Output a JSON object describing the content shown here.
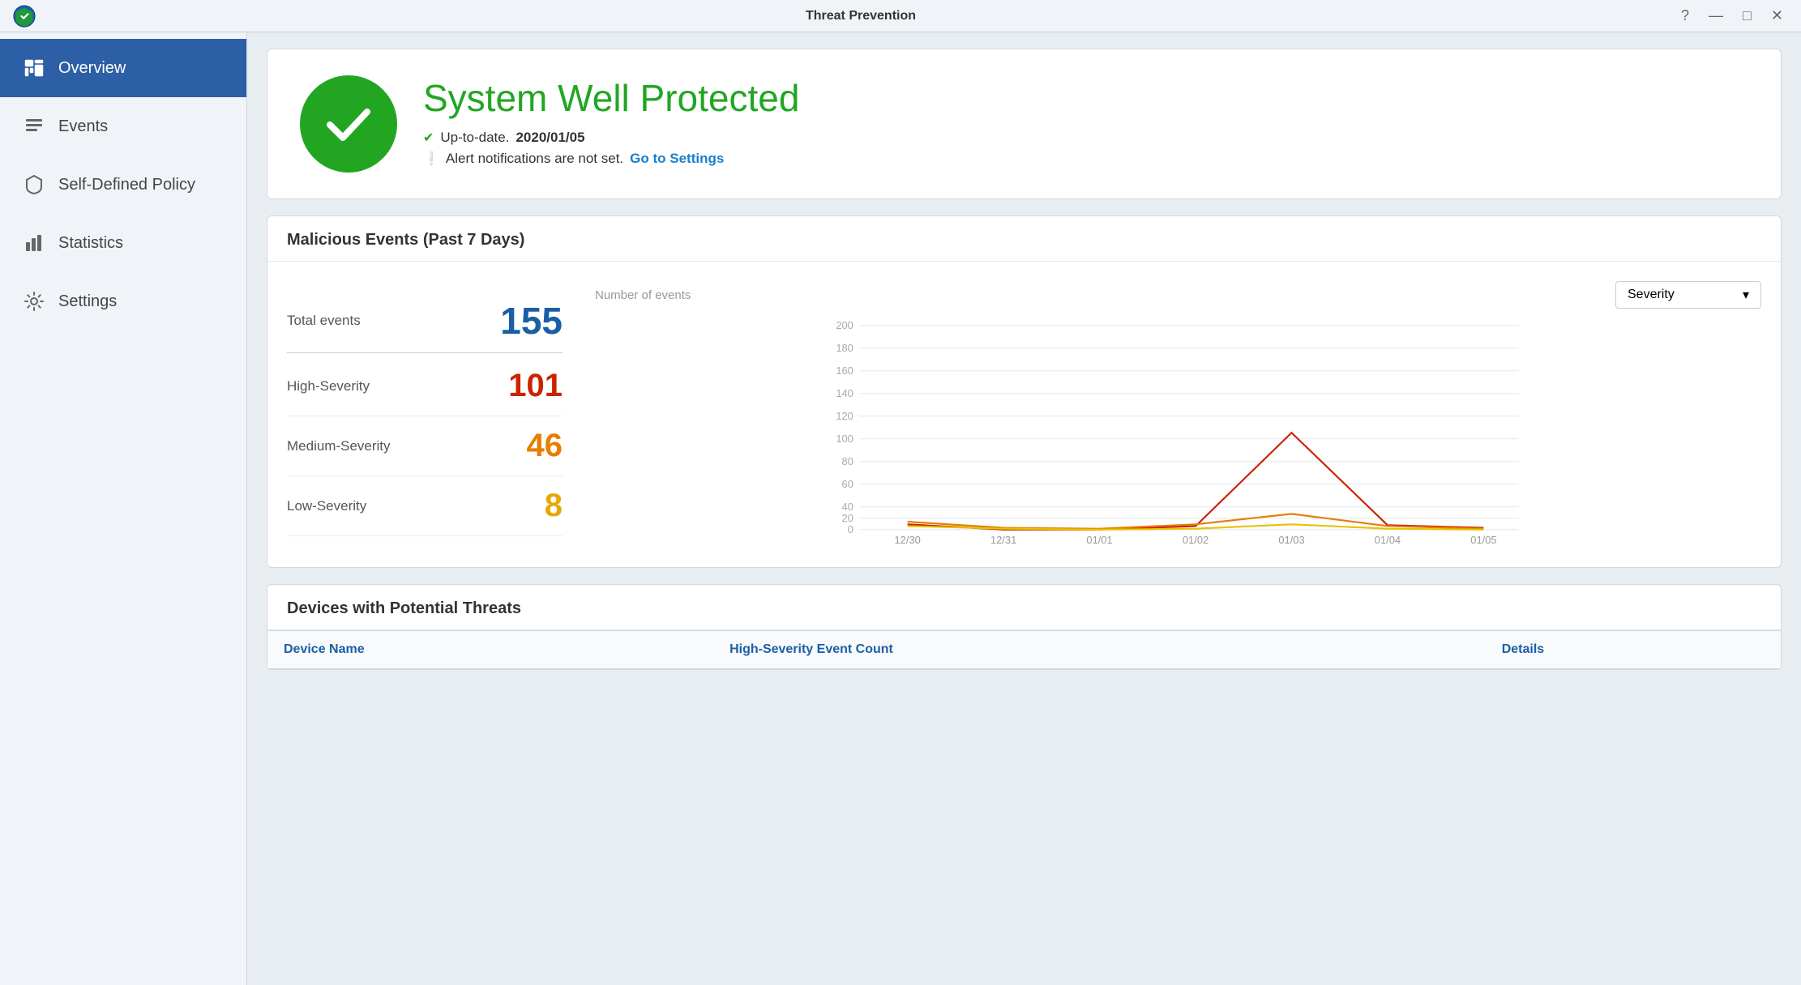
{
  "titlebar": {
    "title": "Threat Prevention",
    "controls": [
      "?",
      "—",
      "□",
      "✕"
    ]
  },
  "sidebar": {
    "items": [
      {
        "id": "overview",
        "label": "Overview",
        "icon": "overview",
        "active": true
      },
      {
        "id": "events",
        "label": "Events",
        "icon": "events",
        "active": false
      },
      {
        "id": "self-defined-policy",
        "label": "Self-Defined Policy",
        "icon": "policy",
        "active": false
      },
      {
        "id": "statistics",
        "label": "Statistics",
        "icon": "statistics",
        "active": false
      },
      {
        "id": "settings",
        "label": "Settings",
        "icon": "settings",
        "active": false
      }
    ]
  },
  "status": {
    "title": "System Well Protected",
    "uptodate_label": "Up-to-date.",
    "uptodate_date": "2020/01/05",
    "alert_text": "Alert notifications are not set.",
    "alert_link": "Go to Settings"
  },
  "malicious_events": {
    "section_title": "Malicious Events (Past 7 Days)",
    "chart_label": "Number of events",
    "dropdown_value": "Severity",
    "stats": {
      "total_label": "Total events",
      "total_value": "155",
      "high_label": "High-Severity",
      "high_value": "101",
      "medium_label": "Medium-Severity",
      "medium_value": "46",
      "low_label": "Low-Severity",
      "low_value": "8"
    },
    "chart": {
      "y_labels": [
        "200",
        "180",
        "160",
        "140",
        "120",
        "100",
        "80",
        "60",
        "40",
        "20",
        "0"
      ],
      "x_labels": [
        "12/30",
        "12/31",
        "01/01",
        "01/02",
        "01/03",
        "01/04",
        "01/05"
      ],
      "high_data": [
        5,
        0,
        0,
        3,
        95,
        4,
        2
      ],
      "medium_data": [
        8,
        2,
        1,
        5,
        15,
        3,
        1
      ],
      "low_data": [
        3,
        1,
        0,
        1,
        5,
        1,
        0
      ]
    }
  },
  "devices": {
    "section_title": "Devices with Potential Threats",
    "columns": [
      "Device Name",
      "High-Severity Event Count",
      "Details"
    ]
  }
}
